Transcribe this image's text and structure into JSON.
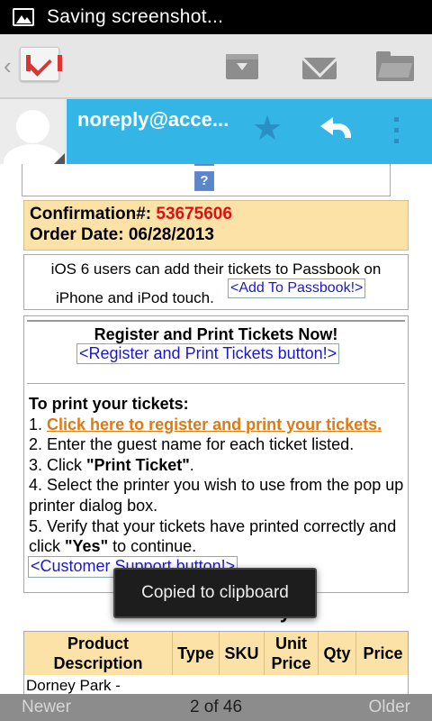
{
  "status_bar": {
    "notification_icon": "image-icon",
    "text": "Saving screenshot..."
  },
  "action_bar": {
    "up_glyph": "‹",
    "app_icon": "gmail-icon",
    "actions": [
      {
        "name": "archive",
        "icon": "archive-icon"
      },
      {
        "name": "mark-unread",
        "icon": "envelope-icon"
      },
      {
        "name": "move-to",
        "icon": "folder-icon"
      }
    ]
  },
  "sender": {
    "name": "noreply@acce...",
    "star_glyph": "★",
    "accent_color": "#33b5e5"
  },
  "email": {
    "confirmation_label": "Confirmation#:",
    "confirmation_number": "53675606",
    "order_date_label": "Order Date:",
    "order_date": "06/28/2013",
    "passbook_line1": "iOS 6 users can add their tickets to Passbook on",
    "passbook_line2": "iPhone and iPod touch.",
    "passbook_button": "<Add To Passbook!>",
    "register_title": "Register and Print Tickets Now!",
    "register_button": "<Register and Print Tickets button!>",
    "print_heading": "To print your tickets:",
    "step1_num": "1.",
    "step1_link": "Click here to register and print your tickets.",
    "step2": "2. Enter the guest name for each ticket listed.",
    "step3_pre": "3. Click ",
    "step3_bold": "\"Print Ticket\"",
    "step3_post": ".",
    "step4": "4. Select the printer you wish to use from the pop up printer dialog box.",
    "step5_pre": "5. Verify that your tickets have printed correctly and click ",
    "step5_bold": "\"Yes\"",
    "step5_post": " to continue.",
    "support_button": "<Customer Support button!>",
    "summary_title": "Order Summary",
    "table_headers": [
      "Product Description",
      "Type",
      "SKU",
      "Unit Price",
      "Qty",
      "Price"
    ],
    "first_row_product": "Dorney Park -"
  },
  "toast": "Copied to clipboard",
  "bottom_bar": {
    "newer": "Newer",
    "position": "2 of 46",
    "older": "Older"
  }
}
